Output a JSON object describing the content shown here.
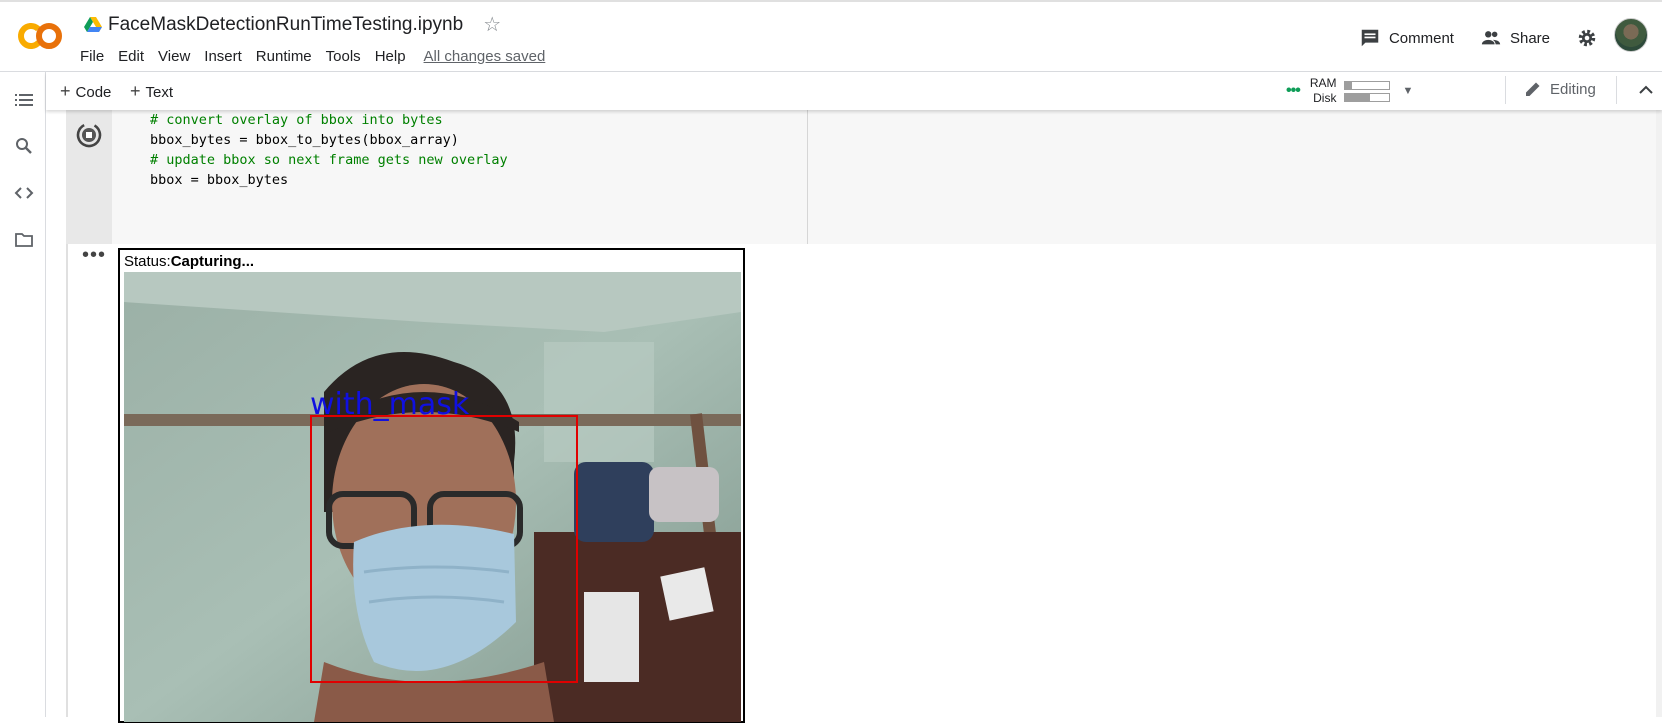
{
  "app": {
    "notebook_title": "FaceMaskDetectionRunTimeTesting.ipynb",
    "save_status": "All changes saved"
  },
  "menu": [
    "File",
    "Edit",
    "View",
    "Insert",
    "Runtime",
    "Tools",
    "Help"
  ],
  "header": {
    "comment_label": "Comment",
    "share_label": "Share"
  },
  "toolbar": {
    "add_code_label": "Code",
    "add_text_label": "Text",
    "ram_label": "RAM",
    "disk_label": "Disk",
    "ram_usage": 0.15,
    "disk_usage": 0.55,
    "editing_label": "Editing"
  },
  "code_lines": [
    {
      "text": "# convert overlay of bbox into bytes",
      "comment": true
    },
    {
      "text": "bbox_bytes = bbox_to_bytes(bbox_array)",
      "comment": false
    },
    {
      "text": "# update bbox so next frame gets new overlay",
      "comment": true
    },
    {
      "text": "bbox = bbox_bytes",
      "comment": false
    }
  ],
  "output": {
    "status_prefix": "Status:",
    "status_value": "Capturing...",
    "detection_label": "with_mask"
  },
  "colors": {
    "accent_orange": "#f9ab00",
    "comment_green": "#008000",
    "box_red": "#e00000",
    "label_blue": "#1010e0"
  }
}
